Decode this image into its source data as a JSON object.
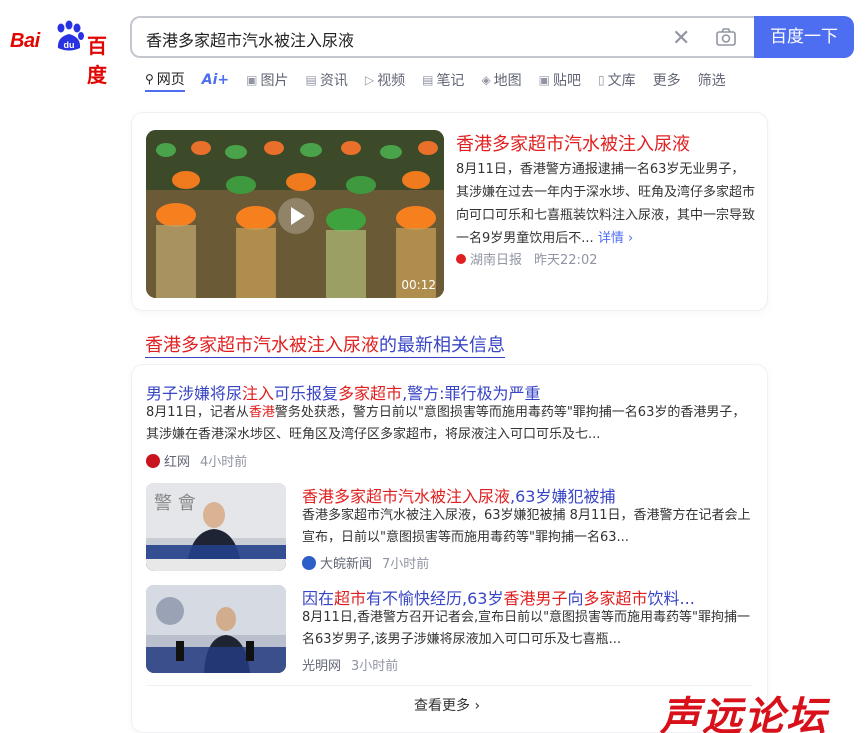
{
  "logo": {
    "latin": "Bai",
    "du": "du",
    "chinese": "百度"
  },
  "search": {
    "query": "香港多家超市汽水被注入尿液",
    "button_label": "百度一下"
  },
  "tabs": [
    {
      "label": "网页",
      "icon": "search-icon",
      "active": true
    },
    {
      "label": "Ai+",
      "icon": "",
      "active": false
    },
    {
      "label": "图片",
      "icon": "image-icon",
      "active": false
    },
    {
      "label": "资讯",
      "icon": "news-icon",
      "active": false
    },
    {
      "label": "视频",
      "icon": "video-icon",
      "active": false
    },
    {
      "label": "笔记",
      "icon": "note-icon",
      "active": false
    },
    {
      "label": "地图",
      "icon": "map-icon",
      "active": false
    },
    {
      "label": "贴吧",
      "icon": "tieba-icon",
      "active": false
    },
    {
      "label": "文库",
      "icon": "doc-icon",
      "active": false
    },
    {
      "label": "更多",
      "icon": "",
      "active": false
    },
    {
      "label": "筛选",
      "icon": "",
      "active": false
    }
  ],
  "top_card": {
    "title": "香港多家超市汽水被注入尿液",
    "desc": "8月11日，香港警方通报逮捕一名63岁无业男子，其涉嫌在过去一年内于深水埗、旺角及湾仔多家超市向可口可乐和七喜瓶装饮料注入尿液，其中一宗导致一名9岁男童饮用后不...",
    "more": "详情",
    "source": "湖南日报",
    "time": "昨天22:02",
    "duration": "00:12"
  },
  "section": {
    "title_red": "香港多家超市汽水被注入尿液",
    "title_rest": "的最新相关信息"
  },
  "news1": {
    "title_parts": [
      "男子涉嫌将尿",
      "注入",
      "可乐报复",
      "多家超市",
      ",警方:罪行极为严重"
    ],
    "desc_a": "8月11日，记者从",
    "desc_red": "香港",
    "desc_b": "警务处获悉，警方日前以\"意图损害等而施用毒药等\"罪拘捕一名63岁的香港男子，其涉嫌在香港深水埗区、旺角区及湾仔区多家超市，将尿液注入可口可乐及七...",
    "source": "红网",
    "time": "4小时前"
  },
  "news2": {
    "title_red": "香港多家超市汽水被注入尿液",
    "title_rest": ",63岁嫌犯被捕",
    "desc": "香港多家超市汽水被注入尿液，63岁嫌犯被捕 8月11日，香港警方在记者会上宣布，日前以\"意图损害等而施用毒药等\"罪拘捕一名63...",
    "source": "大皖新闻",
    "time": "7小时前"
  },
  "news3": {
    "title_parts": [
      "因在",
      "超市",
      "有不愉快经历,63岁",
      "香港男子",
      "向",
      "多家超市",
      "饮料..."
    ],
    "desc": "8月11日,香港警方召开记者会,宣布日前以\"意图损害等而施用毒药等\"罪拘捕一名63岁男子,该男子涉嫌将尿液加入可口可乐及七喜瓶...",
    "source": "光明网",
    "time": "3小时前"
  },
  "see_more": "查看更多",
  "watermark": "声远论坛",
  "colors": {
    "brand_blue": "#4e6ef2",
    "link_blue": "#3845c4",
    "highlight_red": "#e02020",
    "logo_red": "#e10601"
  }
}
